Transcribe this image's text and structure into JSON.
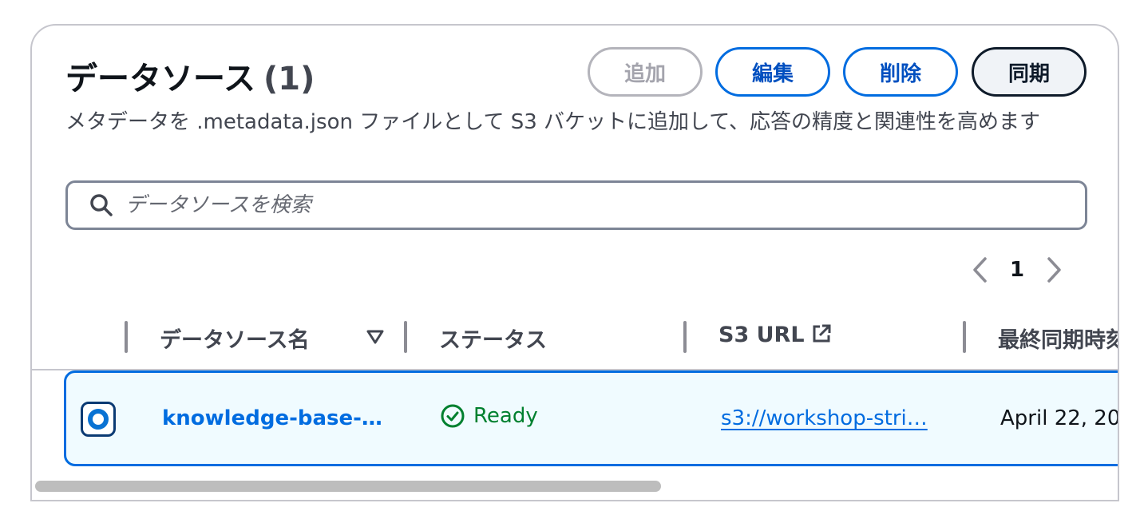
{
  "header": {
    "title": "データソース",
    "count": "(1)"
  },
  "actions": {
    "add_label": "追加",
    "edit_label": "編集",
    "delete_label": "削除",
    "sync_label": "同期"
  },
  "description": "メタデータを .metadata.json ファイルとして S3 バケットに追加して、応答の精度と関連性を高めます",
  "search": {
    "placeholder": "データソースを検索",
    "value": ""
  },
  "pagination": {
    "current_page": "1"
  },
  "table": {
    "columns": [
      {
        "label": "データソース名",
        "sortable": true
      },
      {
        "label": "ステータス"
      },
      {
        "label": "S3 URL",
        "external_link_icon": true
      },
      {
        "label": "最終同期時刻"
      }
    ],
    "rows": [
      {
        "selected": true,
        "name": "knowledge-base-…",
        "status": "Ready",
        "s3_url": "s3://workshop-stri…",
        "last_sync": "April 22, 20"
      }
    ]
  },
  "colors": {
    "accent": "#006ce0",
    "success": "#00802f",
    "selected_row_bg": "#f0fbff",
    "disabled": "#a4a4ad",
    "dark": "#0f1b2a"
  },
  "icons": {
    "search": "search-icon",
    "prev": "chevron-left-icon",
    "next": "chevron-right-icon",
    "sort": "sort-down-icon",
    "external": "external-link-icon",
    "status": "check-circle-icon"
  }
}
